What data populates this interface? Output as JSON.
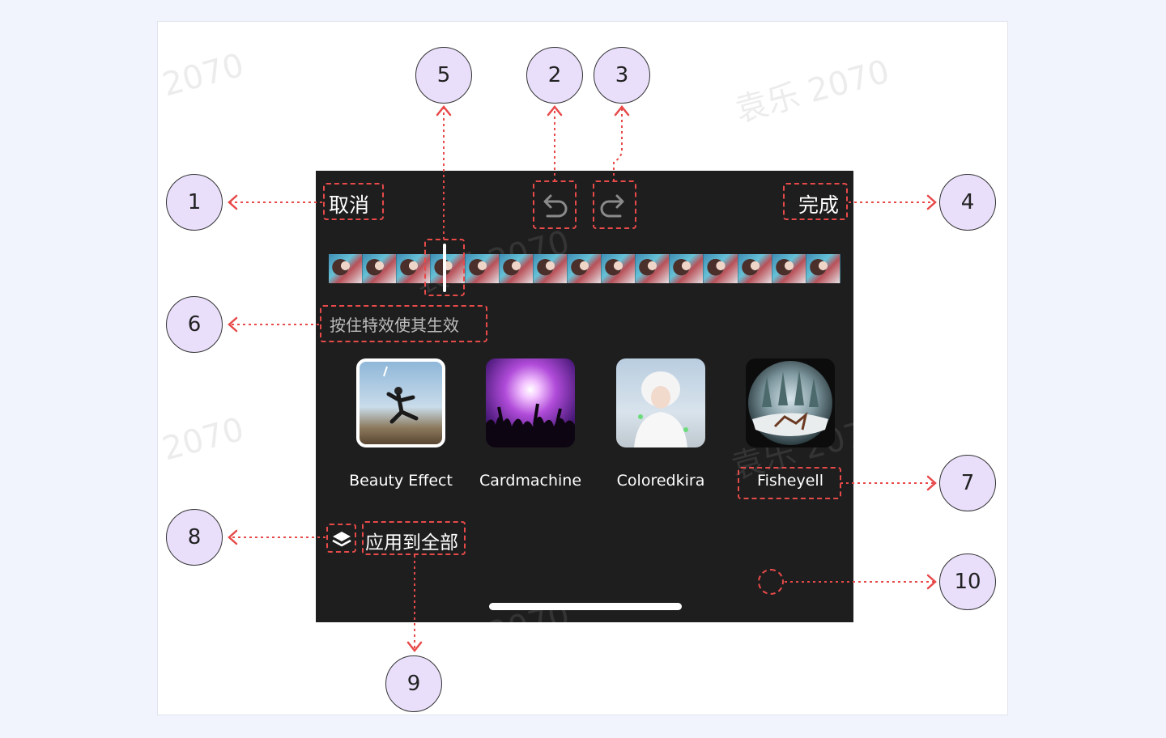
{
  "header": {
    "cancel_label": "取消",
    "done_label": "完成"
  },
  "timeline": {
    "hint": "按住特效使其生效"
  },
  "effects": [
    {
      "label": "Beauty Effect",
      "selected": true
    },
    {
      "label": "Cardmachine",
      "selected": false
    },
    {
      "label": "Coloredkira",
      "selected": false
    },
    {
      "label": "Fisheyell",
      "selected": false
    }
  ],
  "footer": {
    "apply_all_label": "应用到全部"
  },
  "callouts": [
    "1",
    "2",
    "3",
    "4",
    "5",
    "6",
    "7",
    "8",
    "9",
    "10"
  ],
  "watermarks": [
    "2070",
    "袁乐 2070",
    "2070",
    "袁乐 2070",
    "袁乐 2070",
    "袁乐 2070"
  ],
  "colors": {
    "background": "#f1f3fd",
    "screen": "#1e1e1e",
    "annotation": "#e84a4a",
    "callout_fill": "#e9dffb"
  }
}
